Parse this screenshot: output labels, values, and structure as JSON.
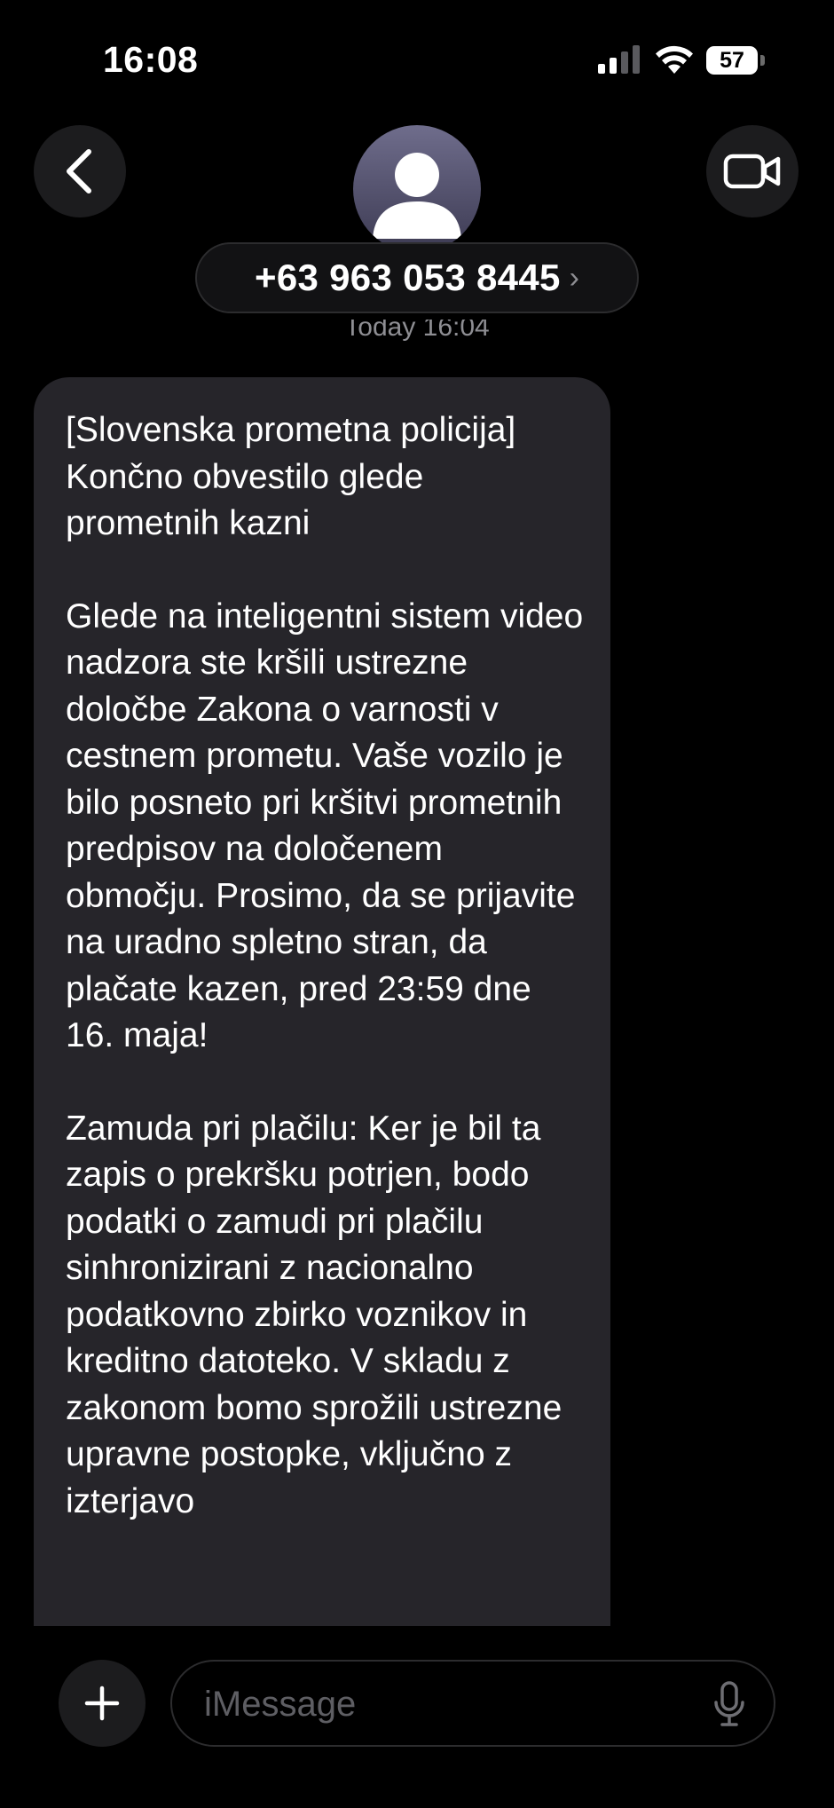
{
  "status_bar": {
    "time": "16:08",
    "battery_level": "57"
  },
  "header": {
    "contact_number": "+63 963 053 8445",
    "chevron": "›",
    "icons": {
      "back": "chevron-left-icon",
      "video": "video-camera-icon",
      "avatar": "person-silhouette-icon"
    }
  },
  "thread": {
    "timestamp": "Today 16:04",
    "message": {
      "paragraph_1": "[Slovenska prometna policija] Končno obvestilo glede prometnih kazni",
      "paragraph_2": "Glede na inteligentni sistem video nadzora ste kršili ustrezne določbe Zakona o varnosti v cestnem prometu. Vaše vozilo je bilo posneto pri kršitvi prometnih predpisov na določenem območju. Prosimo, da se prijavite na uradno spletno stran, da plačate kazen, pred 23:59 dne 16. maja!",
      "paragraph_3": "Zamuda pri plačilu: Ker je bil ta zapis o prekršku potrjen, bodo podatki o zamudi pri plačilu sinhronizirani z nacionalno podatkovno zbirko voznikov in kreditno datoteko. V skladu z zakonom bomo sprožili ustrezne upravne postopke, vključno z izterjavo"
    }
  },
  "composer": {
    "placeholder": "iMessage",
    "icons": {
      "add": "plus-icon",
      "dictation": "microphone-icon"
    }
  },
  "colors": {
    "background": "#000000",
    "bubble": "#26252a",
    "secondary_text": "#8e8e93"
  }
}
